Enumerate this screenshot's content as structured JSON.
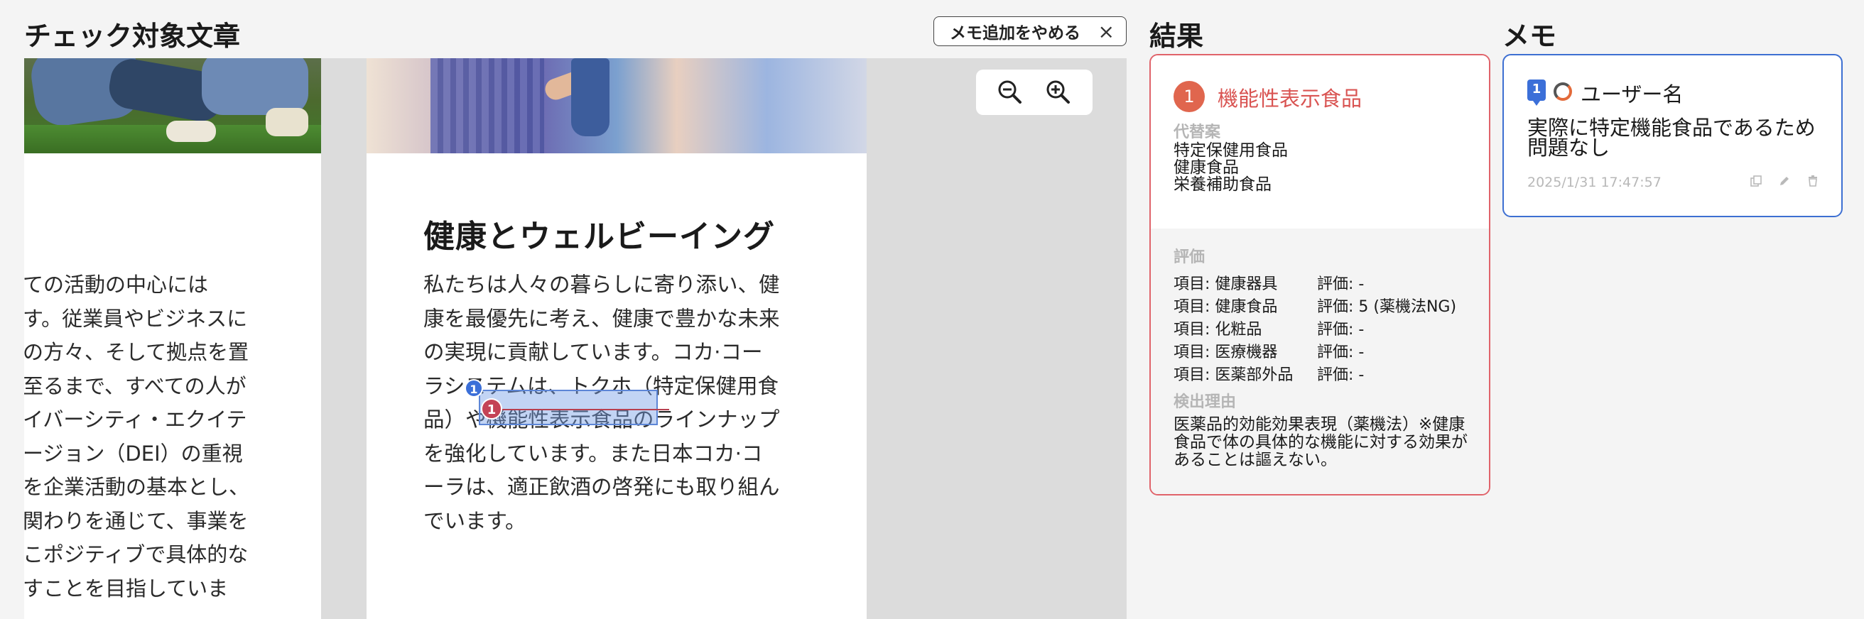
{
  "headers": {
    "check_target": "チェック対象文章",
    "results": "結果",
    "memo": "メモ"
  },
  "toolbar": {
    "stop_memo_label": "メモ追加をやめる",
    "close_symbol": "×"
  },
  "document": {
    "left_page_lines": [
      "ての活動の中心には",
      "す。従業員やビジネスに",
      "の方々、そして拠点を置",
      "至るまで、すべての人が",
      "イバーシティ・エクイテ",
      "ージョン（DEI）の重視",
      "を企業活動の基本とし、",
      "関わりを通じて、事業を",
      "こポジティブで具体的な",
      "すことを目指していま"
    ],
    "heading": "健康とウェルビーイング",
    "body_lines": [
      "私たちは人々の暮らしに寄り添い、健",
      "康を最優先に考え、健康で豊かな未来",
      "の実現に貢献しています。コカ·コー",
      "ラシステムは、トクホ（特定保健用食",
      "品）や機能性表示食品のラインナップ",
      "を強化しています。また日本コカ·コ",
      "ーラは、適正飲酒の啓発にも取り組ん",
      "でいます。"
    ],
    "memo_marker": "1",
    "result_marker": "1"
  },
  "zoom": {
    "out_icon": "zoom-out-icon",
    "in_icon": "zoom-in-icon"
  },
  "result": {
    "number": "1",
    "term": "機能性表示食品",
    "alternatives_label": "代替案",
    "alternatives": [
      "特定保健用食品",
      "健康食品",
      "栄養補助食品"
    ],
    "evaluation_label": "評価",
    "evaluations": [
      {
        "item": "項目: 健康器具",
        "score": "評価: -"
      },
      {
        "item": "項目: 健康食品",
        "score": "評価: 5 (薬機法NG)"
      },
      {
        "item": "項目: 化粧品",
        "score": "評価: -"
      },
      {
        "item": "項目: 医療機器",
        "score": "評価: -"
      },
      {
        "item": "項目: 医薬部外品",
        "score": "評価: -"
      }
    ],
    "reason_label": "検出理由",
    "reason": "医薬品的効能効果表現（薬機法）※健康食品で体の具体的な機能に対する効果があることは謳えない。"
  },
  "memo": {
    "number": "1",
    "user": "ユーザー名",
    "text": "実際に特定機能食品であるため問題なし",
    "date": "2025/1/31 17:47:57",
    "actions": [
      "copy-icon",
      "edit-icon",
      "delete-icon"
    ]
  },
  "colors": {
    "accent_red": "#d95452",
    "memo_blue": "#3b6fd8",
    "badge_orange": "#e0664e"
  }
}
